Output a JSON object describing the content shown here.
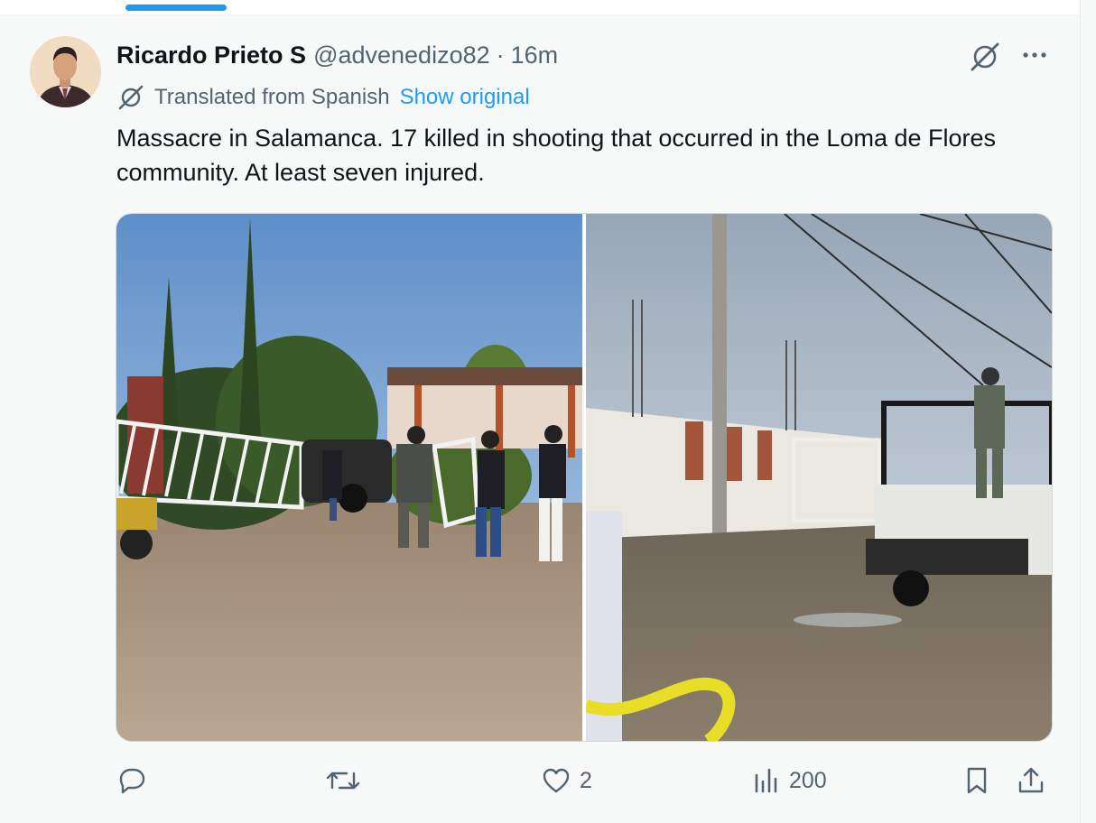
{
  "tweet": {
    "display_name": "Ricardo Prieto S",
    "handle": "@advenedizo82",
    "separator": "·",
    "time": "16m",
    "translated_label": "Translated from Spanish",
    "show_original_label": "Show original",
    "text": "Massacre in Salamanca. 17 killed in shooting that occurred in the Loma de Flores community. At least seven injured."
  },
  "actions": {
    "reply_count": "",
    "retweet_count": "",
    "like_count": "2",
    "views_count": "200"
  },
  "icons": {
    "header": [
      "grok-icon",
      "more-icon"
    ],
    "translate": "translate-icon",
    "action_bar": [
      "reply-icon",
      "retweet-icon",
      "like-icon",
      "views-icon",
      "bookmark-icon",
      "share-icon"
    ]
  },
  "colors": {
    "accent": "#1d9bf0",
    "text_primary": "#0f1419",
    "text_secondary": "#536471",
    "background": "#f7f9f9"
  }
}
